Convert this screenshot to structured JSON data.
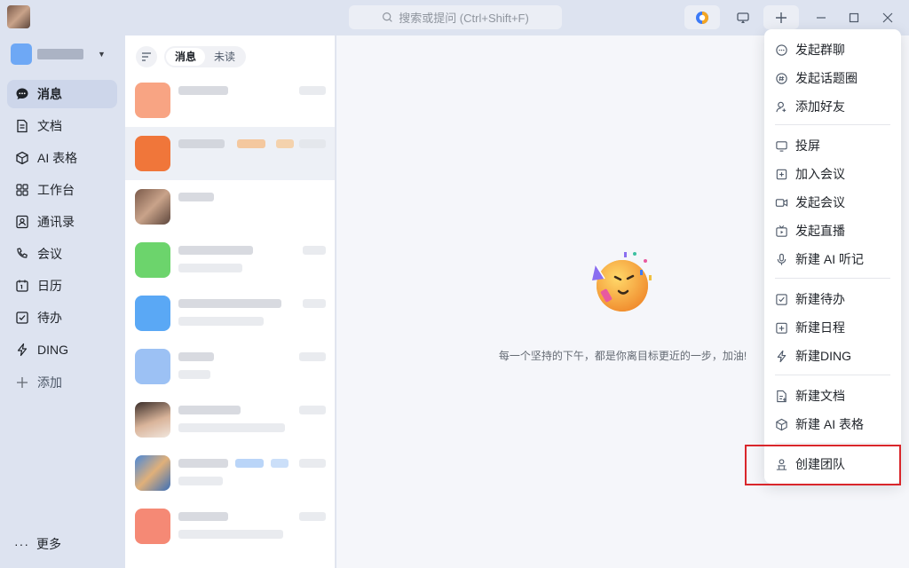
{
  "titlebar": {
    "search_placeholder": "搜索或提问 (Ctrl+Shift+F)"
  },
  "nav": {
    "items": [
      {
        "label": "消息",
        "icon": "chat-bubble-icon",
        "active": true
      },
      {
        "label": "文档",
        "icon": "document-icon"
      },
      {
        "label": "AI 表格",
        "icon": "ai-table-cube-icon"
      },
      {
        "label": "工作台",
        "icon": "grid-apps-icon"
      },
      {
        "label": "通讯录",
        "icon": "contacts-icon"
      },
      {
        "label": "会议",
        "icon": "phone-meeting-icon"
      },
      {
        "label": "日历",
        "icon": "calendar-icon"
      },
      {
        "label": "待办",
        "icon": "todo-check-icon"
      },
      {
        "label": "DING",
        "icon": "lightning-icon"
      },
      {
        "label": "添加",
        "icon": "plus-icon"
      }
    ],
    "more_label": "更多"
  },
  "list": {
    "tabs": [
      "消息",
      "未读"
    ]
  },
  "main": {
    "tip": "每一个坚持的下午，都是你离目标更近的一步，加油!"
  },
  "menu": {
    "groups": [
      [
        {
          "label": "发起群聊",
          "icon": "group-chat-icon"
        },
        {
          "label": "发起话题圈",
          "icon": "hashtag-icon"
        },
        {
          "label": "添加好友",
          "icon": "add-friend-icon"
        }
      ],
      [
        {
          "label": "投屏",
          "icon": "screencast-icon"
        },
        {
          "label": "加入会议",
          "icon": "join-meeting-icon"
        },
        {
          "label": "发起会议",
          "icon": "video-camera-icon"
        },
        {
          "label": "发起直播",
          "icon": "live-tv-icon"
        },
        {
          "label": "新建 AI 听记",
          "icon": "microphone-icon"
        }
      ],
      [
        {
          "label": "新建待办",
          "icon": "todo-check-icon"
        },
        {
          "label": "新建日程",
          "icon": "calendar-plus-icon"
        },
        {
          "label": "新建DING",
          "icon": "lightning-icon"
        }
      ],
      [
        {
          "label": "新建文档",
          "icon": "new-document-icon"
        },
        {
          "label": "新建 AI 表格",
          "icon": "ai-table-cube-icon"
        }
      ],
      [
        {
          "label": "创建团队",
          "icon": "team-icon"
        }
      ]
    ]
  },
  "colors": {
    "accent_highlight": "#d9262b",
    "sidebar_bg": "#dde3f0",
    "main_bg": "#f5f6fa"
  }
}
